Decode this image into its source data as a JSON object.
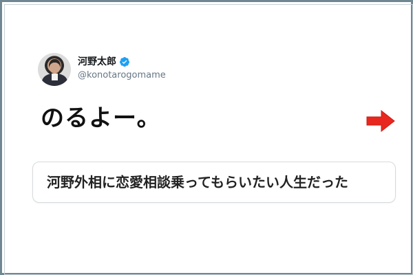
{
  "profile": {
    "display_name": "河野太郎",
    "handle": "@konotarogomame",
    "verified": true,
    "avatar_icon": "profile-photo-icon",
    "verified_icon": "verified-badge-icon",
    "verified_color": "#1da1f2"
  },
  "tweet": {
    "text": "のるよー。"
  },
  "caption": {
    "text": "河野外相に恋愛相談乗ってもらいたい人生だった"
  },
  "decoration": {
    "arrow_icon": "right-arrow-icon",
    "arrow_color": "#e8271f",
    "frame_color": "#6f8791"
  }
}
